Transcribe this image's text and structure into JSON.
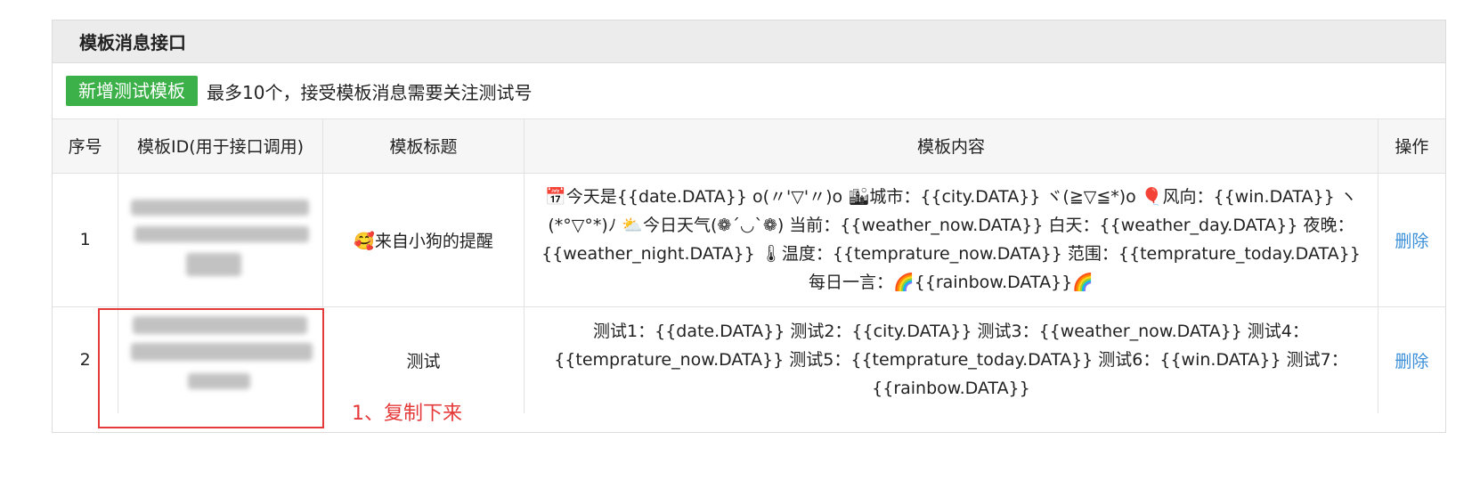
{
  "panel": {
    "title": "模板消息接口"
  },
  "toolbar": {
    "add_button": "新增测试模板",
    "note": "最多10个，接受模板消息需要关注测试号"
  },
  "table": {
    "headers": [
      "序号",
      "模板ID(用于接口调用)",
      "模板标题",
      "模板内容",
      "操作"
    ],
    "rows": [
      {
        "index": "1",
        "template_id": "",
        "title": "🥰来自小狗的提醒",
        "content": "📅今天是{{date.DATA}} o(〃'▽'〃)o 🏙城市：{{city.DATA}} ヾ(≧▽≦*)o 🎈风向：{{win.DATA}} ヽ(*°▽°*)ﾉ ⛅今日天气(❁´◡`❁) 当前：{{weather_now.DATA}} 白天：{{weather_day.DATA}} 夜晚：{{weather_night.DATA}} 🌡温度：{{temprature_now.DATA}} 范围：{{temprature_today.DATA}} 每日一言：🌈{{rainbow.DATA}}🌈",
        "action": "删除"
      },
      {
        "index": "2",
        "template_id": "",
        "title": "测试",
        "content": "测试1：{{date.DATA}} 测试2：{{city.DATA}} 测试3：{{weather_now.DATA}} 测试4：{{temprature_now.DATA}} 测试5：{{temprature_today.DATA}} 测试6：{{win.DATA}} 测试7：{{rainbow.DATA}}",
        "action": "删除"
      }
    ]
  },
  "annotation": {
    "text": "1、复制下来",
    "color": "#e53a3a"
  },
  "colors": {
    "accent_green": "#3cb049",
    "link_blue": "#3a8fd8"
  }
}
